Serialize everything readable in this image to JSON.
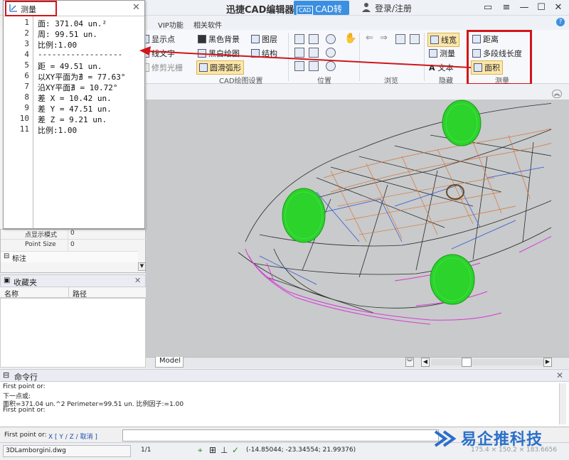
{
  "titlebar": {
    "app_title": "迅捷CAD编辑器",
    "converter_badge": "CAD",
    "converter_label": "CAD转换器",
    "login": "登录/注册",
    "help": "?"
  },
  "ribbon": {
    "tabs": [
      "VIP功能",
      "相关软件"
    ],
    "cad_settings": {
      "items": [
        "显示点",
        "线文字",
        "修剪光栅",
        "黑色背景",
        "黑白绘图",
        "圆滑弧形",
        "图层",
        "结构"
      ],
      "label": "CAD绘图设置"
    },
    "position_label": "位置",
    "browse_label": "浏览",
    "hide": {
      "items": [
        "线宽",
        "测量",
        "文本"
      ],
      "label": "隐藏"
    },
    "measure": {
      "items": [
        "距离",
        "多段线长度",
        "面积"
      ],
      "label": "测量"
    }
  },
  "measure_panel": {
    "title": "测量",
    "lines": [
      {
        "no": "1",
        "text": "面: 371.04 un.²"
      },
      {
        "no": "2",
        "text": "周: 99.51 un."
      },
      {
        "no": "3",
        "text": "比例:1.00"
      },
      {
        "no": "4",
        "text": "------------------"
      },
      {
        "no": "5",
        "text": "距 = 49.51 un."
      },
      {
        "no": "6",
        "text": "以XY平面为∄ = 77.63°"
      },
      {
        "no": "7",
        "text": "沿XY平面∄ = 10.72°"
      },
      {
        "no": "8",
        "text": "差 X = 10.42 un."
      },
      {
        "no": "9",
        "text": "差 Y = 47.51 un."
      },
      {
        "no": "10",
        "text": "差 Z = 9.21 un."
      },
      {
        "no": "11",
        "text": "比例:1.00"
      }
    ]
  },
  "properties": {
    "rows": [
      {
        "name": "点显示模式",
        "value": "0"
      },
      {
        "name": "Point Size",
        "value": "0"
      }
    ],
    "section": "标注"
  },
  "favorites": {
    "title": "收藏夹",
    "col_name": "名称",
    "col_path": "路径"
  },
  "canvas": {
    "model_tab": "Model"
  },
  "command": {
    "title": "命令行",
    "output": [
      "First point or:",
      "下一点或:",
      "面积=371.04 un.^2 Perimeter=99.51 un. 比例因子:=1.00",
      "First point or:"
    ],
    "prompt": "First point or:",
    "options": "X [ Y / Z / 取消 ]"
  },
  "status": {
    "file": "3DLamborgini.dwg",
    "page": "1/1",
    "coords": "(-14.85044; -23.34554; 21.99376)",
    "right_coords": "175.4 × 150.2 × 183.6656"
  },
  "watermark": "易企推科技",
  "colors": {
    "highlight_red": "#d0161b",
    "accent_blue": "#3b8fe0",
    "wheel_green": "#2bd32b",
    "body_magenta": "#d63ad8"
  }
}
